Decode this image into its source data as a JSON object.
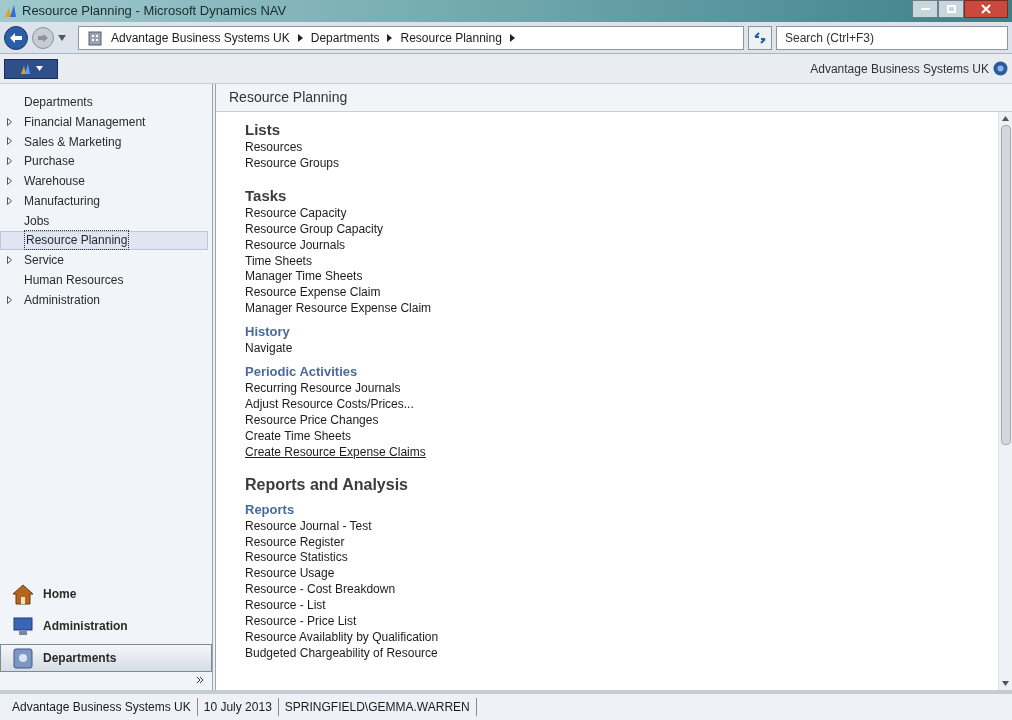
{
  "window": {
    "title": "Resource Planning - Microsoft Dynamics NAV"
  },
  "address_bar": {
    "crumbs": [
      "Advantage Business Systems UK",
      "Departments",
      "Resource Planning"
    ],
    "search": {
      "placeholder": "Search (Ctrl+F3)"
    }
  },
  "company": "Advantage Business Systems UK",
  "sidebar": {
    "items": [
      {
        "label": "Departments",
        "expandable": false,
        "selected": false
      },
      {
        "label": "Financial Management",
        "expandable": true,
        "selected": false
      },
      {
        "label": "Sales & Marketing",
        "expandable": true,
        "selected": false
      },
      {
        "label": "Purchase",
        "expandable": true,
        "selected": false
      },
      {
        "label": "Warehouse",
        "expandable": true,
        "selected": false
      },
      {
        "label": "Manufacturing",
        "expandable": true,
        "selected": false
      },
      {
        "label": "Jobs",
        "expandable": false,
        "selected": false
      },
      {
        "label": "Resource Planning",
        "expandable": false,
        "selected": true
      },
      {
        "label": "Service",
        "expandable": true,
        "selected": false
      },
      {
        "label": "Human Resources",
        "expandable": false,
        "selected": false
      },
      {
        "label": "Administration",
        "expandable": true,
        "selected": false
      }
    ],
    "nav_buttons": [
      {
        "label": "Home",
        "kind": "home",
        "selected": false
      },
      {
        "label": "Administration",
        "kind": "admin",
        "selected": false
      },
      {
        "label": "Departments",
        "kind": "departments",
        "selected": true
      }
    ]
  },
  "content": {
    "title": "Resource Planning",
    "entries": [
      {
        "kind": "heading",
        "label": "Lists"
      },
      {
        "kind": "link",
        "label": "Resources",
        "hovered": false
      },
      {
        "kind": "link",
        "label": "Resource Groups",
        "hovered": false
      },
      {
        "kind": "heading",
        "label": "Tasks"
      },
      {
        "kind": "link",
        "label": "Resource Capacity",
        "hovered": false
      },
      {
        "kind": "link",
        "label": "Resource Group Capacity",
        "hovered": false
      },
      {
        "kind": "link",
        "label": "Resource Journals",
        "hovered": false
      },
      {
        "kind": "link",
        "label": "Time Sheets",
        "hovered": false
      },
      {
        "kind": "link",
        "label": "Manager Time Sheets",
        "hovered": false
      },
      {
        "kind": "link",
        "label": "Resource Expense Claim",
        "hovered": false
      },
      {
        "kind": "link",
        "label": "Manager Resource Expense Claim",
        "hovered": false
      },
      {
        "kind": "subheading",
        "label": "History"
      },
      {
        "kind": "link",
        "label": "Navigate",
        "hovered": false
      },
      {
        "kind": "subheading",
        "label": "Periodic Activities"
      },
      {
        "kind": "link",
        "label": "Recurring Resource Journals",
        "hovered": false
      },
      {
        "kind": "link",
        "label": "Adjust Resource Costs/Prices...",
        "hovered": false
      },
      {
        "kind": "link",
        "label": "Resource Price Changes",
        "hovered": false
      },
      {
        "kind": "link",
        "label": "Create Time Sheets",
        "hovered": false
      },
      {
        "kind": "link",
        "label": "Create Resource Expense Claims",
        "hovered": true
      },
      {
        "kind": "group",
        "label": "Reports and Analysis"
      },
      {
        "kind": "subheading",
        "label": "Reports"
      },
      {
        "kind": "link",
        "label": "Resource Journal - Test",
        "hovered": false
      },
      {
        "kind": "link",
        "label": "Resource Register",
        "hovered": false
      },
      {
        "kind": "link",
        "label": "Resource Statistics",
        "hovered": false
      },
      {
        "kind": "link",
        "label": "Resource Usage",
        "hovered": false
      },
      {
        "kind": "link",
        "label": "Resource - Cost Breakdown",
        "hovered": false
      },
      {
        "kind": "link",
        "label": "Resource - List",
        "hovered": false
      },
      {
        "kind": "link",
        "label": "Resource - Price List",
        "hovered": false
      },
      {
        "kind": "link",
        "label": "Resource Availablity by Qualification",
        "hovered": false
      },
      {
        "kind": "link",
        "label": "Budgeted Chargeability of Resource",
        "hovered": false
      }
    ]
  },
  "status_bar": [
    "Advantage Business Systems UK",
    "10 July 2013",
    "SPRINGFIELD\\GEMMA.WARREN"
  ]
}
